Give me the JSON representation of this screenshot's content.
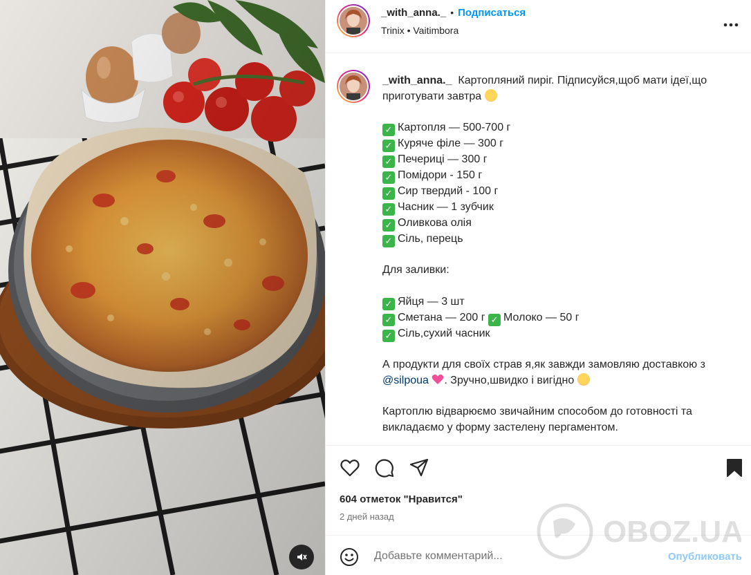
{
  "header": {
    "username": "_with_anna._",
    "separator": "•",
    "follow_label": "Подписаться",
    "location": "Trinix • Vaitimbora"
  },
  "caption": {
    "username": "_with_anna._",
    "intro": "Картопляний пиріг. Підписуйся,щоб мати ідеї,що приготувати завтра",
    "ingredients": [
      "Картопля — 500-700 г",
      "Куряче філе — 300 г",
      "Печериці — 300 г",
      "Помідори - 150 г",
      "Сир твердий - 100 г",
      "Часник — 1 зубчик",
      "Оливкова олія",
      "Сіль, перець"
    ],
    "filling_title": "Для заливки:",
    "filling": {
      "eggs": "Яйця — 3 шт",
      "sour_cream": "Сметана — 200 г",
      "milk": "Молоко — 50 г",
      "salt": "Сіль,сухий часник"
    },
    "delivery_before": "А продукти для своїх страв я,як завжди замовляю доставкою з",
    "mention": "@silpoua",
    "delivery_after": ". Зручно,швидко і вигідно",
    "method": "Картоплю відварюємо звичайним способом до готовності та викладаємо у форму застелену пергаментом."
  },
  "actions": {
    "likes": "604 отметок \"Нравится\"",
    "time": "2 дней назад"
  },
  "comment": {
    "placeholder": "Добавьте комментарий...",
    "post_label": "Опубликовать"
  },
  "watermark": {
    "text": "OBOZ.UA"
  },
  "colors": {
    "follow": "#0095f6",
    "post_disabled": "#8fc9f8",
    "mention": "#00376b",
    "check_emoji": "#3bb54a"
  },
  "icons": [
    "more-icon",
    "heart-icon",
    "comment-icon",
    "share-icon",
    "bookmark-icon",
    "emoji-icon",
    "mute-icon",
    "check-emoji-icon"
  ]
}
